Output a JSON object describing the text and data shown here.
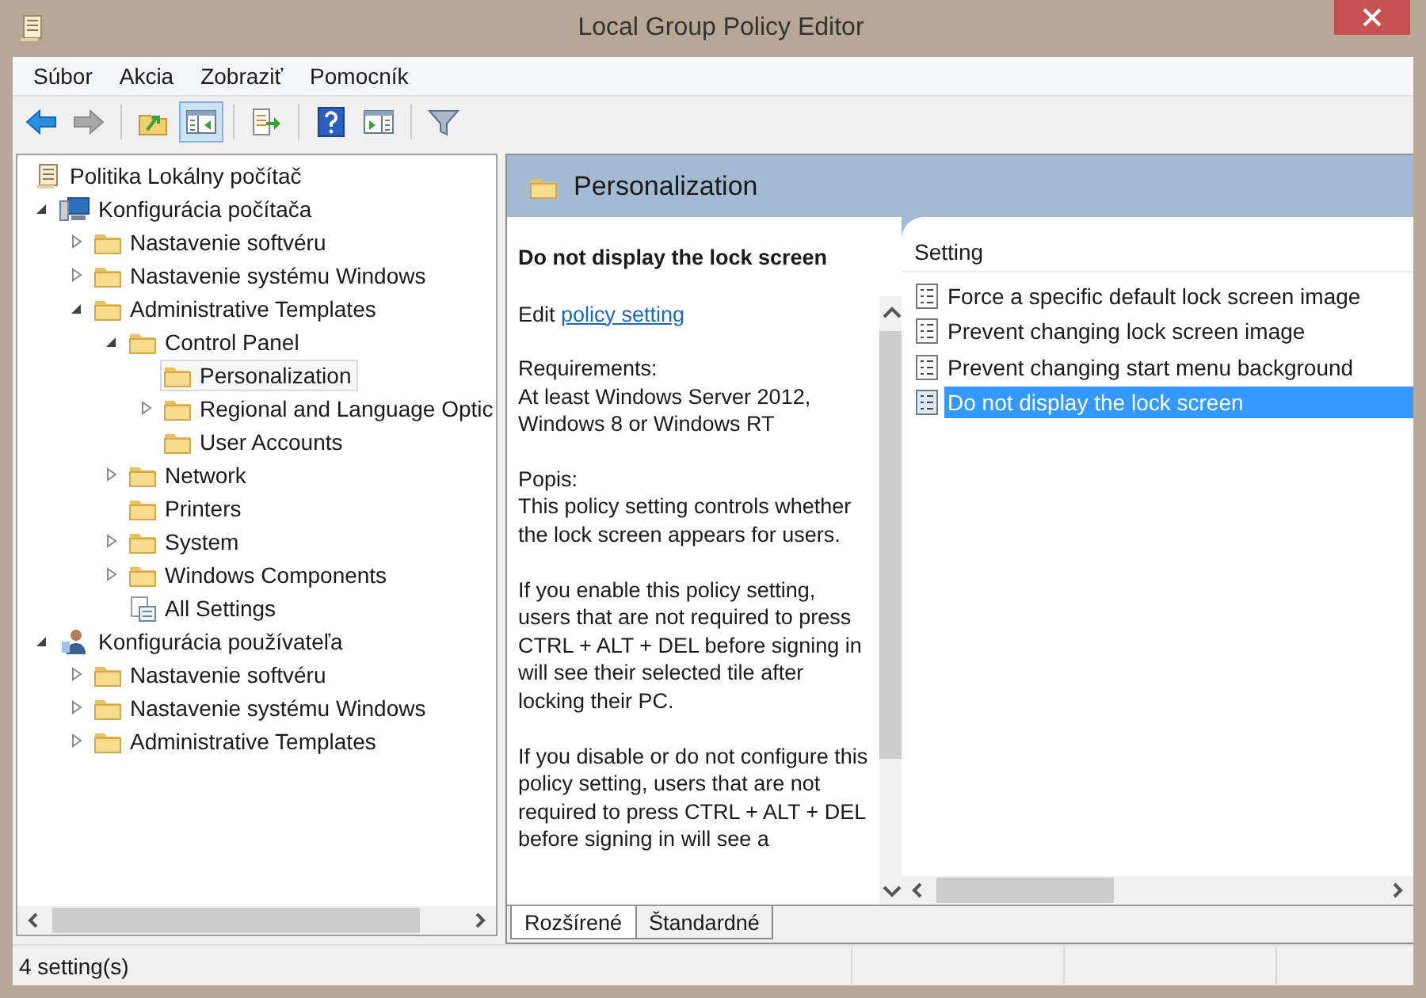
{
  "window": {
    "title": "Local Group Policy Editor"
  },
  "menu": [
    "Súbor",
    "Akcia",
    "Zobraziť",
    "Pomocník"
  ],
  "toolbar": [
    {
      "kind": "back",
      "pressed": false,
      "disabled": false
    },
    {
      "kind": "forward",
      "pressed": false,
      "disabled": true
    },
    {
      "kind": "separator"
    },
    {
      "kind": "up",
      "pressed": false,
      "disabled": false
    },
    {
      "kind": "tree",
      "pressed": true,
      "disabled": false
    },
    {
      "kind": "separator"
    },
    {
      "kind": "export",
      "pressed": false,
      "disabled": false
    },
    {
      "kind": "separator"
    },
    {
      "kind": "help",
      "pressed": false,
      "disabled": false
    },
    {
      "kind": "pane",
      "pressed": false,
      "disabled": false
    },
    {
      "kind": "separator"
    },
    {
      "kind": "filter",
      "pressed": false,
      "disabled": false
    }
  ],
  "tree": [
    {
      "label": "Politika Lokálny počítač",
      "kind": "policy",
      "selected": false,
      "children": [
        {
          "label": "Konfigurácia počítača",
          "kind": "computer",
          "selected": false,
          "expanded": true,
          "children": [
            {
              "label": "Nastavenie softvéru",
              "kind": "folder",
              "selected": false,
              "expanded": false
            },
            {
              "label": "Nastavenie systému Windows",
              "kind": "folder",
              "selected": false,
              "expanded": false
            },
            {
              "label": "Administrative Templates",
              "kind": "folder",
              "selected": false,
              "expanded": true,
              "children": [
                {
                  "label": "Control Panel",
                  "kind": "folder",
                  "selected": false,
                  "expanded": true,
                  "children": [
                    {
                      "label": "Personalization",
                      "kind": "folder",
                      "selected": true
                    },
                    {
                      "label": "Regional and Language Optic",
                      "kind": "folder",
                      "selected": false,
                      "expanded": false
                    },
                    {
                      "label": "User Accounts",
                      "kind": "folder",
                      "selected": false
                    }
                  ]
                },
                {
                  "label": "Network",
                  "kind": "folder",
                  "selected": false,
                  "expanded": false
                },
                {
                  "label": "Printers",
                  "kind": "folder",
                  "selected": false
                },
                {
                  "label": "System",
                  "kind": "folder",
                  "selected": false,
                  "expanded": false
                },
                {
                  "label": "Windows Components",
                  "kind": "folder",
                  "selected": false,
                  "expanded": false
                },
                {
                  "label": "All Settings",
                  "kind": "settings",
                  "selected": false
                }
              ]
            }
          ]
        },
        {
          "label": "Konfigurácia používateľa",
          "kind": "user",
          "selected": false,
          "expanded": true,
          "children": [
            {
              "label": "Nastavenie softvéru",
              "kind": "folder",
              "selected": false,
              "expanded": false
            },
            {
              "label": "Nastavenie systému Windows",
              "kind": "folder",
              "selected": false,
              "expanded": false
            },
            {
              "label": "Administrative Templates",
              "kind": "folder",
              "selected": false,
              "expanded": false
            }
          ]
        }
      ]
    }
  ],
  "panel": {
    "title": "Personalization",
    "description": {
      "title": "Do not display the lock screen",
      "edit_text": "Edit",
      "edit_link": "policy setting",
      "requirements_label": "Requirements:",
      "requirements": "At least Windows Server 2012, Windows 8 or Windows RT",
      "about_label": "Popis:",
      "paragraphs": [
        "This policy setting controls whether the lock screen appears for users.",
        "If you enable this policy setting, users that are not required to press CTRL + ALT + DEL before signing in will see their selected tile after locking their PC.",
        "If you disable or do not configure this policy setting, users that are not required to press CTRL + ALT + DEL before signing in will see a"
      ]
    },
    "columns": [
      "Setting"
    ],
    "settings": [
      {
        "label": "Force a specific default lock screen image",
        "selected": false
      },
      {
        "label": "Prevent changing lock screen image",
        "selected": false
      },
      {
        "label": "Prevent changing start menu background",
        "selected": false
      },
      {
        "label": "Do not display the lock screen",
        "selected": true
      }
    ],
    "tabs": [
      {
        "label": "Rozšírené",
        "selected": true
      },
      {
        "label": "Štandardné",
        "selected": false
      }
    ]
  },
  "status_bar": {
    "text": "4 setting(s)"
  }
}
